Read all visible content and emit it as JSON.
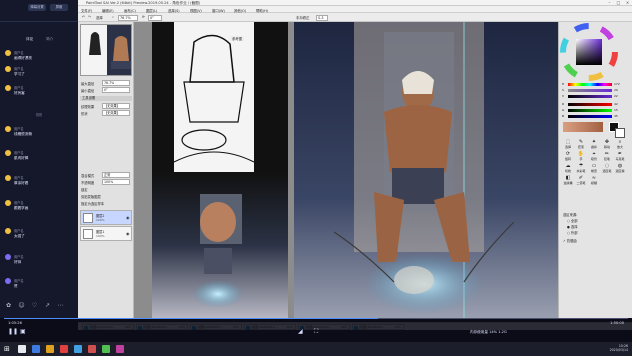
{
  "chat": {
    "top_buttons": [
      "弹幕设置",
      "屏蔽"
    ],
    "tabs": [
      "评论",
      "简介"
    ],
    "active_tab": "评论",
    "separator_label": "刚刚",
    "messages": [
      {
        "name": "用户名",
        "text": "画得好漂亮"
      },
      {
        "name": "用户名",
        "text": "学习了"
      },
      {
        "name": "用户名",
        "text": "好厉害"
      },
      {
        "name": "用户名",
        "text": "线稿很流畅"
      },
      {
        "name": "用户名",
        "text": "肌肉好棒"
      },
      {
        "name": "用户名",
        "text": "厚涂好看"
      },
      {
        "name": "用户名",
        "text": "跟着学画"
      },
      {
        "name": "用户名",
        "text": "太强了"
      },
      {
        "name": "用户名",
        "text": "好帅"
      },
      {
        "name": "用户名",
        "text": "赞"
      }
    ]
  },
  "window": {
    "title": "PaintTool SAI Ver.2 (64bit) Preview.2019.05.24 - 角色作业 / (截图)",
    "menu": [
      "文件(F)",
      "编辑(E)",
      "画布(C)",
      "图层(L)",
      "选择(S)",
      "视图(V)",
      "窗口(W)",
      "其他(O)",
      "帮助(H)"
    ],
    "toolbar": {
      "select_label": "选择",
      "zoom": "76.7%",
      "angle": "0°",
      "stabilizer_label": "手抖修正",
      "stabilizer_value": "S-3"
    },
    "reference_label": "参考图",
    "left_panel": {
      "brush_size_label": "最大直径",
      "brush_size": "76.7%",
      "min_size_label": "最小直径",
      "min_size": "0°",
      "texture_label": "纹理效果",
      "texture_value": "【无效果】",
      "shape_label": "形状",
      "shape_value": "【无效果】",
      "blend_label": "混合模式",
      "blend_value": "正常",
      "opacity_label": "不透明度",
      "opacity_value": "100%",
      "lock_label": "锁定",
      "checkbox_1": "剪贴蒙版图层",
      "checkbox_2": "指定为选区样本",
      "section_title": "工具设置",
      "layers": [
        {
          "name": "图层2",
          "mode": "正常",
          "opacity": "100%"
        },
        {
          "name": "图层1",
          "mode": "正常",
          "opacity": "100%"
        }
      ]
    },
    "right_panel": {
      "sliders": [
        {
          "key": "H",
          "value": "172"
        },
        {
          "key": "S",
          "value": "20"
        },
        {
          "key": "V",
          "value": "22"
        },
        {
          "key": "R",
          "value": "42"
        },
        {
          "key": "G",
          "value": "15"
        },
        {
          "key": "B",
          "value": "45"
        }
      ],
      "tools": [
        {
          "label": "选择",
          "glyph": "⬚"
        },
        {
          "label": "套索",
          "glyph": "✎"
        },
        {
          "label": "魔棒",
          "glyph": "✦"
        },
        {
          "label": "移动",
          "glyph": "✥"
        },
        {
          "label": "放大",
          "glyph": "⌕"
        },
        {
          "label": "旋转",
          "glyph": "⟳"
        },
        {
          "label": "手",
          "glyph": "✋"
        },
        {
          "label": "吸管",
          "glyph": "⌖"
        },
        {
          "label": "铅笔",
          "glyph": "✏"
        },
        {
          "label": "马克笔",
          "glyph": "✒"
        },
        {
          "label": "喷枪",
          "glyph": "☁"
        },
        {
          "label": "水彩笔",
          "glyph": "☂"
        },
        {
          "label": "橡皮",
          "glyph": "▭"
        },
        {
          "label": "选区笔",
          "glyph": "◌"
        },
        {
          "label": "选区擦",
          "glyph": "◍"
        },
        {
          "label": "油漆桶",
          "glyph": "◧"
        },
        {
          "label": "二值笔",
          "glyph": "✐"
        },
        {
          "label": "模糊",
          "glyph": "≈"
        }
      ],
      "option_title": "选区来源:",
      "options": [
        "○ 全部",
        "● 选择",
        "○ 外部"
      ],
      "checkbox_label": "✓ 抗锯齿"
    },
    "doc_tabs": [
      {
        "name": "(截图)20200314...",
        "pct": "14%"
      },
      {
        "name": "(截图)20200314...",
        "pct": "14%"
      },
      {
        "name": "(截图)20200314...",
        "pct": "14%"
      },
      {
        "name": "(截图)20200314...",
        "pct": "14%"
      },
      {
        "name": "(截图)20200314...",
        "pct": "14%"
      },
      {
        "name": "(截图)20200314...",
        "pct": "14%"
      }
    ]
  },
  "video": {
    "time_current": "1:05:26",
    "time_total": "1:50:00",
    "progress": 0.6,
    "status_right": "内存使用量 14% 1.2G"
  },
  "taskbar": {
    "time": "10:26",
    "date": "2020/03/14"
  },
  "colors": {
    "accent": "#4f8cff",
    "chat_bg": "#14182a",
    "avatar": "#f0c040"
  }
}
